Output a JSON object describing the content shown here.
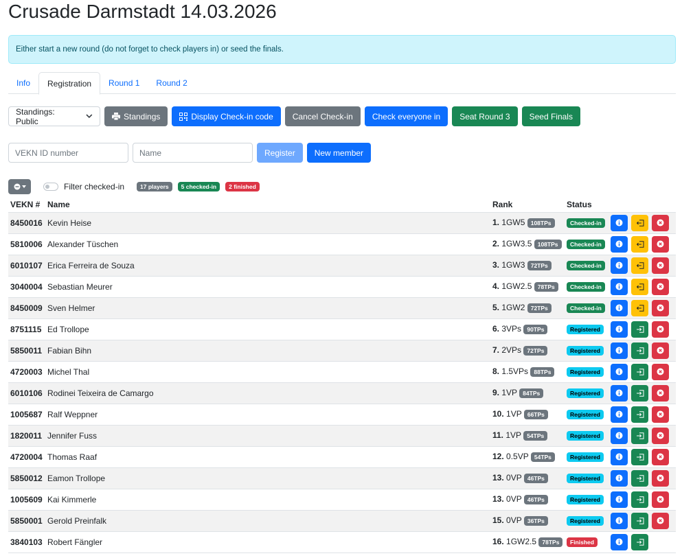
{
  "title": "Crusade Darmstadt 14.03.2026",
  "alert": "Either start a new round (do not forget to check players in) or seed the finals.",
  "tabs": [
    {
      "label": "Info",
      "active": false
    },
    {
      "label": "Registration",
      "active": true
    },
    {
      "label": "Round 1",
      "active": false
    },
    {
      "label": "Round 2",
      "active": false
    }
  ],
  "toolbar": {
    "standings_select": "Standings: Public",
    "standings_btn": "Standings",
    "display_checkin": "Display Check-in code",
    "cancel_checkin": "Cancel Check-in",
    "check_everyone": "Check everyone in",
    "seat_round": "Seat Round 3",
    "seed_finals": "Seed Finals"
  },
  "register": {
    "vekn_placeholder": "VEKN ID number",
    "name_placeholder": "Name",
    "register_btn": "Register",
    "new_member_btn": "New member"
  },
  "filter": {
    "label": "Filter checked-in",
    "players_badge": "17 players",
    "checkedin_badge": "5 checked-in",
    "finished_badge": "2 finished"
  },
  "columns": {
    "vekn": "VEKN #",
    "name": "Name",
    "rank": "Rank",
    "status": "Status"
  },
  "colors": {
    "primary": "#0d6efd",
    "success": "#198754",
    "warning": "#ffc107",
    "danger": "#dc3545",
    "info": "#0dcaf0",
    "secondary": "#6c757d"
  },
  "players": [
    {
      "vekn": "8450016",
      "name": "Kevin Heise",
      "rank": "1.",
      "score": "1GW5",
      "tps": "108TPs",
      "status": "Checked-in",
      "action": "checkout"
    },
    {
      "vekn": "5810006",
      "name": "Alexander Tüschen",
      "rank": "2.",
      "score": "1GW3.5",
      "tps": "108TPs",
      "status": "Checked-in",
      "action": "checkout"
    },
    {
      "vekn": "6010107",
      "name": "Erica Ferreira de Souza",
      "rank": "3.",
      "score": "1GW3",
      "tps": "72TPs",
      "status": "Checked-in",
      "action": "checkout"
    },
    {
      "vekn": "3040004",
      "name": "Sebastian Meurer",
      "rank": "4.",
      "score": "1GW2.5",
      "tps": "78TPs",
      "status": "Checked-in",
      "action": "checkout"
    },
    {
      "vekn": "8450009",
      "name": "Sven Helmer",
      "rank": "5.",
      "score": "1GW2",
      "tps": "72TPs",
      "status": "Checked-in",
      "action": "checkout"
    },
    {
      "vekn": "8751115",
      "name": "Ed Trollope",
      "rank": "6.",
      "score": "3VPs",
      "tps": "90TPs",
      "status": "Registered",
      "action": "checkin"
    },
    {
      "vekn": "5850011",
      "name": "Fabian Bihn",
      "rank": "7.",
      "score": "2VPs",
      "tps": "72TPs",
      "status": "Registered",
      "action": "checkin"
    },
    {
      "vekn": "4720003",
      "name": "Michel Thal",
      "rank": "8.",
      "score": "1.5VPs",
      "tps": "88TPs",
      "status": "Registered",
      "action": "checkin"
    },
    {
      "vekn": "6010106",
      "name": "Rodinei Teixeira de Camargo",
      "rank": "9.",
      "score": "1VP",
      "tps": "84TPs",
      "status": "Registered",
      "action": "checkin"
    },
    {
      "vekn": "1005687",
      "name": "Ralf Weppner",
      "rank": "10.",
      "score": "1VP",
      "tps": "66TPs",
      "status": "Registered",
      "action": "checkin"
    },
    {
      "vekn": "1820011",
      "name": "Jennifer Fuss",
      "rank": "11.",
      "score": "1VP",
      "tps": "54TPs",
      "status": "Registered",
      "action": "checkin"
    },
    {
      "vekn": "4720004",
      "name": "Thomas Raaf",
      "rank": "12.",
      "score": "0.5VP",
      "tps": "54TPs",
      "status": "Registered",
      "action": "checkin"
    },
    {
      "vekn": "5850012",
      "name": "Eamon Trollope",
      "rank": "13.",
      "score": "0VP",
      "tps": "46TPs",
      "status": "Registered",
      "action": "checkin"
    },
    {
      "vekn": "1005609",
      "name": "Kai Kimmerle",
      "rank": "13.",
      "score": "0VP",
      "tps": "46TPs",
      "status": "Registered",
      "action": "checkin"
    },
    {
      "vekn": "5850001",
      "name": "Gerold Preinfalk",
      "rank": "15.",
      "score": "0VP",
      "tps": "36TPs",
      "status": "Registered",
      "action": "checkin"
    },
    {
      "vekn": "3840103",
      "name": "Robert Fängler",
      "rank": "16.",
      "score": "1GW2.5",
      "tps": "78TPs",
      "status": "Finished",
      "action": "finished"
    }
  ]
}
